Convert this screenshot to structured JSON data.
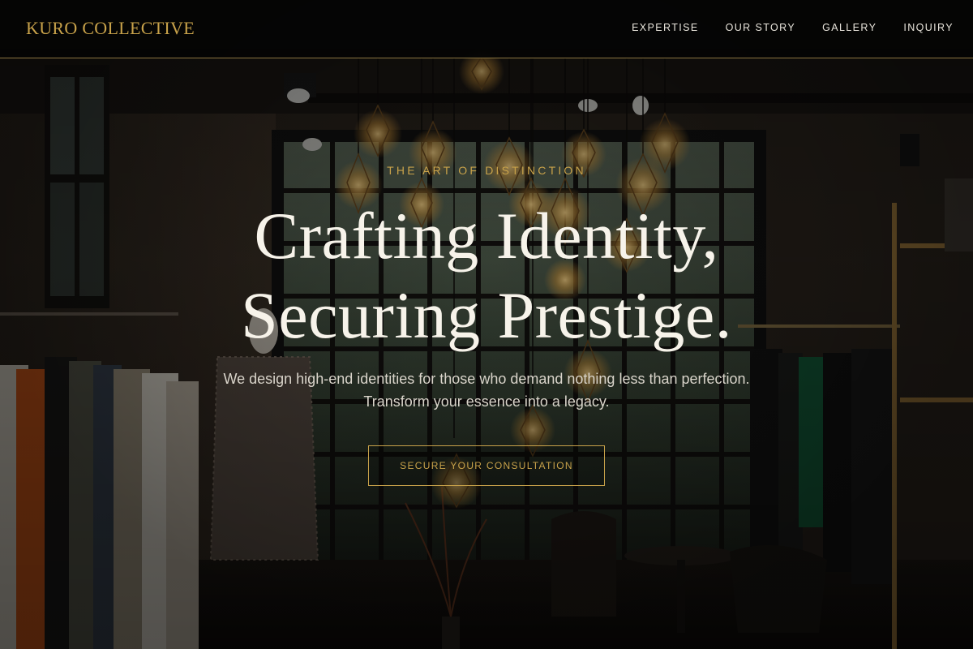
{
  "header": {
    "brand": "KURO COLLECTIVE",
    "nav": [
      {
        "label": "EXPERTISE"
      },
      {
        "label": "OUR STORY"
      },
      {
        "label": "GALLERY"
      },
      {
        "label": "INQUIRY"
      }
    ]
  },
  "hero": {
    "eyebrow": "THE ART OF DISTINCTION",
    "headline_line1": "Crafting Identity,",
    "headline_line2": "Securing Prestige.",
    "subtitle": "We design high-end identities for those who demand nothing less than perfection. Transform your essence into a legacy.",
    "cta_label": "SECURE YOUR CONSULTATION"
  },
  "colors": {
    "accent_gold": "#c8a24a",
    "header_bg": "#040404",
    "headline_text": "#f7f3ea",
    "body_text": "#d9d4ca"
  },
  "background": {
    "description_icon": "boutique-interior-photo"
  }
}
